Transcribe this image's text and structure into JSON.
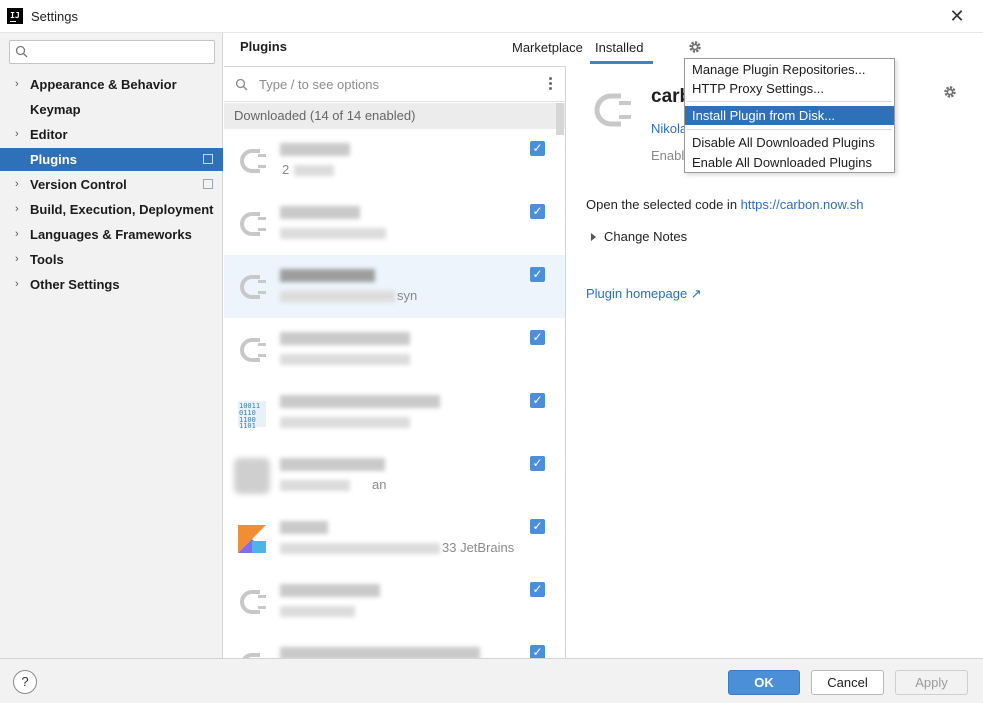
{
  "window": {
    "title": "Settings"
  },
  "sidebar": {
    "search_placeholder": "",
    "items": [
      {
        "label": "Appearance & Behavior",
        "expandable": true
      },
      {
        "label": "Keymap",
        "expandable": false
      },
      {
        "label": "Editor",
        "expandable": true
      },
      {
        "label": "Plugins",
        "expandable": false,
        "selected": true
      },
      {
        "label": "Version Control",
        "expandable": true
      },
      {
        "label": "Build, Execution, Deployment",
        "expandable": true
      },
      {
        "label": "Languages & Frameworks",
        "expandable": true
      },
      {
        "label": "Tools",
        "expandable": true
      },
      {
        "label": "Other Settings",
        "expandable": true
      }
    ]
  },
  "plugins": {
    "title": "Plugins",
    "tabs": {
      "marketplace": "Marketplace",
      "installed": "Installed"
    },
    "search_placeholder": "Type / to see options",
    "group_header": "Downloaded (14 of 14 enabled)",
    "rows": [
      {
        "vendor_partial": "2",
        "checked": true
      },
      {
        "vendor_partial": "",
        "checked": true
      },
      {
        "vendor_partial": "syn",
        "checked": true
      },
      {
        "vendor_partial": "",
        "checked": true
      },
      {
        "vendor_partial": "",
        "checked": true
      },
      {
        "vendor_partial": "an",
        "checked": true
      },
      {
        "vendor_partial": "33  JetBrains",
        "checked": true
      },
      {
        "vendor_partial": "",
        "checked": true
      },
      {
        "vendor_partial": "",
        "checked": true
      }
    ]
  },
  "detail": {
    "name_partial": "carb",
    "vendor_partial": "Nikola",
    "status_partial": "Enabl",
    "description": "Open the selected code in ",
    "description_link": "https://carbon.now.sh",
    "change_notes": "Change Notes",
    "homepage": "Plugin homepage ↗"
  },
  "gear_menu": {
    "items": [
      "Manage Plugin Repositories...",
      "HTTP Proxy Settings...",
      "Install Plugin from Disk...",
      "Disable All Downloaded Plugins",
      "Enable All Downloaded Plugins"
    ],
    "highlighted_index": 2
  },
  "footer": {
    "help": "?",
    "ok": "OK",
    "cancel": "Cancel",
    "apply": "Apply"
  },
  "colors": {
    "accent": "#2e71b8",
    "link": "#2970c4",
    "checkbox": "#4a8fd8"
  }
}
